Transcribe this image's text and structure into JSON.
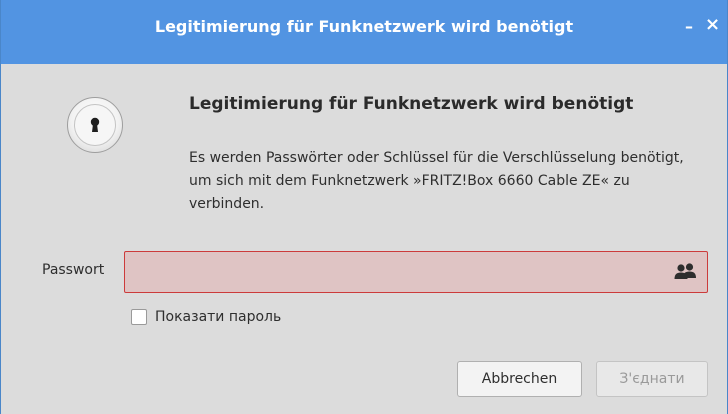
{
  "window": {
    "title": "Legitimierung für Funknetzwerk wird benötigt",
    "minimize_glyph": "–",
    "close_glyph": "×"
  },
  "dialog": {
    "icon": "lock-icon",
    "heading": "Legitimierung für Funknetzwerk wird benötigt",
    "description": "Es werden Passwörter oder Schlüssel für die Verschlüsselung benötigt, um sich mit dem Funknetzwerk »FRITZ!Box 6660 Cable ZE« zu verbinden."
  },
  "password": {
    "label": "Passwort",
    "value": "",
    "field_state": "invalid",
    "icon": "users-icon"
  },
  "show_password": {
    "label": "Показати пароль",
    "checked": false
  },
  "buttons": {
    "cancel_label": "Abbrechen",
    "connect_label": "З'єднати",
    "connect_enabled": false
  },
  "colors": {
    "titlebar": "#5294e2",
    "dialog_bg": "#dcdcdc",
    "error_border": "#cc3b3b",
    "error_fill": "#dfc4c4"
  }
}
